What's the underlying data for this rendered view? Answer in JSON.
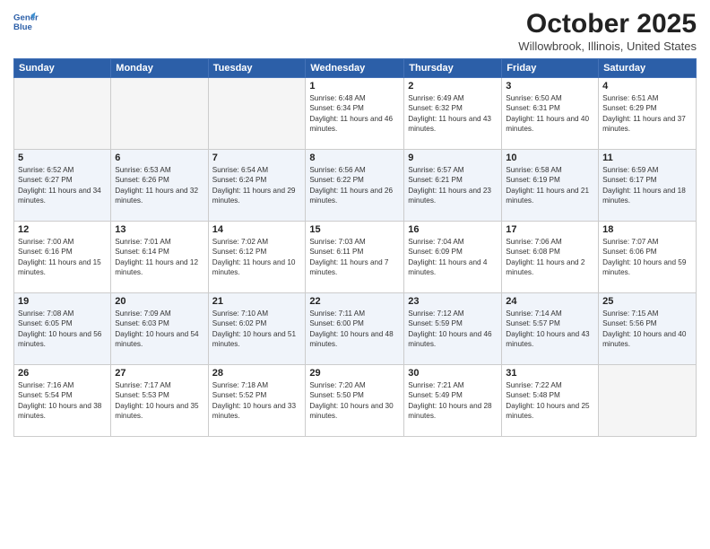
{
  "header": {
    "logo_line1": "General",
    "logo_line2": "Blue",
    "month_title": "October 2025",
    "location": "Willowbrook, Illinois, United States"
  },
  "weekdays": [
    "Sunday",
    "Monday",
    "Tuesday",
    "Wednesday",
    "Thursday",
    "Friday",
    "Saturday"
  ],
  "weeks": [
    [
      {
        "day": "",
        "info": ""
      },
      {
        "day": "",
        "info": ""
      },
      {
        "day": "",
        "info": ""
      },
      {
        "day": "1",
        "info": "Sunrise: 6:48 AM\nSunset: 6:34 PM\nDaylight: 11 hours and 46 minutes."
      },
      {
        "day": "2",
        "info": "Sunrise: 6:49 AM\nSunset: 6:32 PM\nDaylight: 11 hours and 43 minutes."
      },
      {
        "day": "3",
        "info": "Sunrise: 6:50 AM\nSunset: 6:31 PM\nDaylight: 11 hours and 40 minutes."
      },
      {
        "day": "4",
        "info": "Sunrise: 6:51 AM\nSunset: 6:29 PM\nDaylight: 11 hours and 37 minutes."
      }
    ],
    [
      {
        "day": "5",
        "info": "Sunrise: 6:52 AM\nSunset: 6:27 PM\nDaylight: 11 hours and 34 minutes."
      },
      {
        "day": "6",
        "info": "Sunrise: 6:53 AM\nSunset: 6:26 PM\nDaylight: 11 hours and 32 minutes."
      },
      {
        "day": "7",
        "info": "Sunrise: 6:54 AM\nSunset: 6:24 PM\nDaylight: 11 hours and 29 minutes."
      },
      {
        "day": "8",
        "info": "Sunrise: 6:56 AM\nSunset: 6:22 PM\nDaylight: 11 hours and 26 minutes."
      },
      {
        "day": "9",
        "info": "Sunrise: 6:57 AM\nSunset: 6:21 PM\nDaylight: 11 hours and 23 minutes."
      },
      {
        "day": "10",
        "info": "Sunrise: 6:58 AM\nSunset: 6:19 PM\nDaylight: 11 hours and 21 minutes."
      },
      {
        "day": "11",
        "info": "Sunrise: 6:59 AM\nSunset: 6:17 PM\nDaylight: 11 hours and 18 minutes."
      }
    ],
    [
      {
        "day": "12",
        "info": "Sunrise: 7:00 AM\nSunset: 6:16 PM\nDaylight: 11 hours and 15 minutes."
      },
      {
        "day": "13",
        "info": "Sunrise: 7:01 AM\nSunset: 6:14 PM\nDaylight: 11 hours and 12 minutes."
      },
      {
        "day": "14",
        "info": "Sunrise: 7:02 AM\nSunset: 6:12 PM\nDaylight: 11 hours and 10 minutes."
      },
      {
        "day": "15",
        "info": "Sunrise: 7:03 AM\nSunset: 6:11 PM\nDaylight: 11 hours and 7 minutes."
      },
      {
        "day": "16",
        "info": "Sunrise: 7:04 AM\nSunset: 6:09 PM\nDaylight: 11 hours and 4 minutes."
      },
      {
        "day": "17",
        "info": "Sunrise: 7:06 AM\nSunset: 6:08 PM\nDaylight: 11 hours and 2 minutes."
      },
      {
        "day": "18",
        "info": "Sunrise: 7:07 AM\nSunset: 6:06 PM\nDaylight: 10 hours and 59 minutes."
      }
    ],
    [
      {
        "day": "19",
        "info": "Sunrise: 7:08 AM\nSunset: 6:05 PM\nDaylight: 10 hours and 56 minutes."
      },
      {
        "day": "20",
        "info": "Sunrise: 7:09 AM\nSunset: 6:03 PM\nDaylight: 10 hours and 54 minutes."
      },
      {
        "day": "21",
        "info": "Sunrise: 7:10 AM\nSunset: 6:02 PM\nDaylight: 10 hours and 51 minutes."
      },
      {
        "day": "22",
        "info": "Sunrise: 7:11 AM\nSunset: 6:00 PM\nDaylight: 10 hours and 48 minutes."
      },
      {
        "day": "23",
        "info": "Sunrise: 7:12 AM\nSunset: 5:59 PM\nDaylight: 10 hours and 46 minutes."
      },
      {
        "day": "24",
        "info": "Sunrise: 7:14 AM\nSunset: 5:57 PM\nDaylight: 10 hours and 43 minutes."
      },
      {
        "day": "25",
        "info": "Sunrise: 7:15 AM\nSunset: 5:56 PM\nDaylight: 10 hours and 40 minutes."
      }
    ],
    [
      {
        "day": "26",
        "info": "Sunrise: 7:16 AM\nSunset: 5:54 PM\nDaylight: 10 hours and 38 minutes."
      },
      {
        "day": "27",
        "info": "Sunrise: 7:17 AM\nSunset: 5:53 PM\nDaylight: 10 hours and 35 minutes."
      },
      {
        "day": "28",
        "info": "Sunrise: 7:18 AM\nSunset: 5:52 PM\nDaylight: 10 hours and 33 minutes."
      },
      {
        "day": "29",
        "info": "Sunrise: 7:20 AM\nSunset: 5:50 PM\nDaylight: 10 hours and 30 minutes."
      },
      {
        "day": "30",
        "info": "Sunrise: 7:21 AM\nSunset: 5:49 PM\nDaylight: 10 hours and 28 minutes."
      },
      {
        "day": "31",
        "info": "Sunrise: 7:22 AM\nSunset: 5:48 PM\nDaylight: 10 hours and 25 minutes."
      },
      {
        "day": "",
        "info": ""
      }
    ]
  ]
}
